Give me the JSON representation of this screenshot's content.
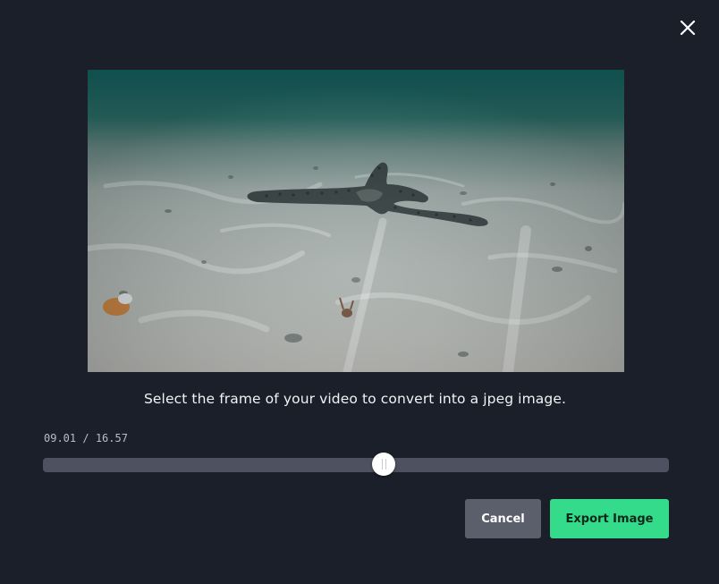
{
  "dialog": {
    "caption": "Select the frame of your video to convert into a jpeg image.",
    "current_time": "09.01",
    "time_separator": "/",
    "total_time": "16.57",
    "slider_position": 0.544,
    "buttons": {
      "cancel_label": "Cancel",
      "export_label": "Export Image"
    },
    "icons": {
      "close": "close-icon"
    }
  },
  "colors": {
    "background": "#1b1f2a",
    "accent": "#33db8a",
    "cancel_button": "#5b5e6b",
    "slider_track": "#4e5260"
  }
}
